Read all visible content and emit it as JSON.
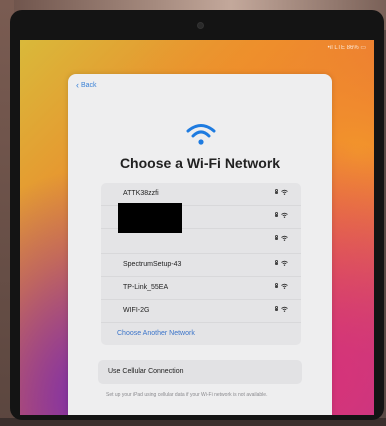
{
  "status_bar": {
    "text": "•ıl LTE 86% ▭"
  },
  "nav": {
    "back_label": "Back"
  },
  "header": {
    "title": "Choose a Wi-Fi Network"
  },
  "networks": [
    {
      "name": "ATTK38zzfi"
    },
    {
      "name": ""
    },
    {
      "name": ""
    },
    {
      "name": "SpectrumSetup-43"
    },
    {
      "name": "TP-Link_55EA"
    },
    {
      "name": "WIFI-2G"
    }
  ],
  "choose_another": {
    "label": "Choose Another Network"
  },
  "cellular": {
    "label": "Use Cellular Connection",
    "note": "Set up your iPad using cellular data if your Wi-Fi network is not available."
  },
  "colors": {
    "accent": "#3b82d6"
  }
}
